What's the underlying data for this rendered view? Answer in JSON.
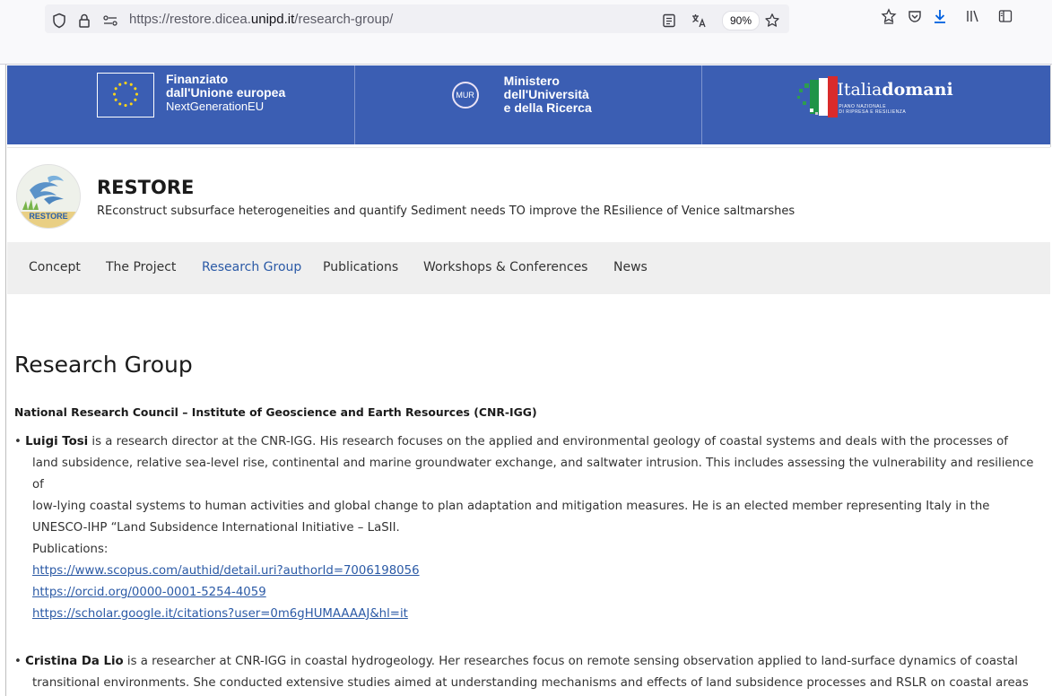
{
  "browser": {
    "url_prefix": "https://restore.dicea.",
    "url_domain": "unipd.it",
    "url_path": "/research-group/",
    "zoom": "90%"
  },
  "funding_banner": {
    "eu": {
      "line1": "Finanziato",
      "line2": "dall'Unione europea",
      "line3": "NextGenerationEU"
    },
    "mur": {
      "badge": "MUR",
      "line1": "Ministero",
      "line2": "dell'Università",
      "line3": "e della Ricerca"
    },
    "italia": {
      "word_a": "Italia",
      "word_b": "domani",
      "sub1": "PIANO NAZIONALE",
      "sub2": "DI RIPRESA E RESILIENZA"
    }
  },
  "site": {
    "logo_text": "RESTORE",
    "title": "RESTORE",
    "description": "REconstruct subsurface heterogeneities and quantify Sediment needs TO improve the REsilience of Venice saltmarshes"
  },
  "nav": {
    "items": [
      {
        "label": "Concept"
      },
      {
        "label": "The Project"
      },
      {
        "label": "Research Group"
      },
      {
        "label": "Publications"
      },
      {
        "label": "Workshops & Conferences"
      },
      {
        "label": "News"
      }
    ]
  },
  "content": {
    "title": "Research Group",
    "institution": "National Research Council – Institute of Geoscience and Earth Resources (CNR-IGG)",
    "members": [
      {
        "name": "Luigi Tosi",
        "bio_lines": [
          " is a research director at the CNR-IGG. His research focuses on the applied and environmental geology of coastal systems and deals with the processes of",
          "land subsidence, relative sea-level rise, continental and marine groundwater exchange, and saltwater intrusion. This includes assessing the vulnerability and resilience of",
          "low-lying coastal systems to human activities and global change to plan adaptation and mitigation measures. He is an elected member representing Italy in the",
          "UNESCO-IHP “Land Subsidence International Initiative – LaSII."
        ],
        "publications_label": "Publications:",
        "links": [
          "https://www.scopus.com/authid/detail.uri?authorId=7006198056",
          "https://orcid.org/0000-0001-5254-4059",
          "https://scholar.google.it/citations?user=0m6gHUMAAAAJ&hl=it"
        ]
      },
      {
        "name": "Cristina Da Lio",
        "bio_lines": [
          " is a researcher at CNR-IGG in coastal hydrogeology. Her researches focus on remote sensing observation applied to land-surface dynamics of coastal",
          "transitional environments. She conducted extensive studies aimed at understanding mechanisms and effects of land subsidence processes and RSLR on coastal areas"
        ]
      }
    ]
  },
  "colors": {
    "banner_blue": "#3b5eb3",
    "link_blue": "#2b5aa6",
    "download_blue": "#0060df"
  }
}
